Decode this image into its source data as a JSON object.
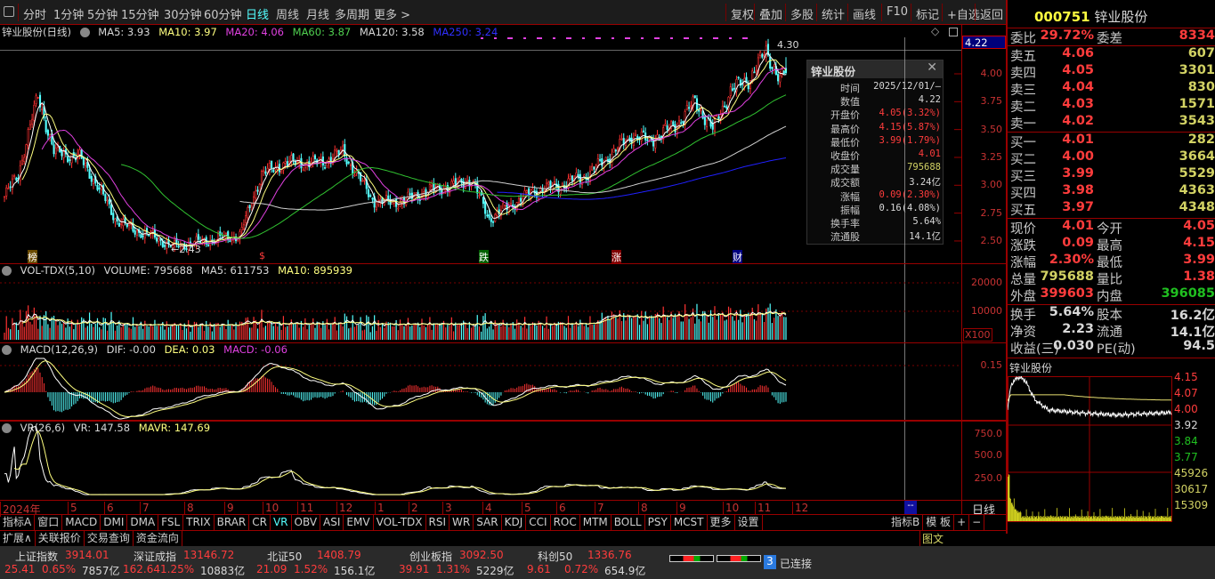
{
  "toolbar": {
    "left": [
      "分时",
      "1分钟",
      "5分钟",
      "15分钟",
      "30分钟",
      "60分钟",
      "日线",
      "周线",
      "月线",
      "多周期",
      "更多 >"
    ],
    "active": "日线",
    "right": [
      "复权",
      "叠加",
      "多股",
      "统计",
      "画线",
      "F10",
      "标记",
      "+自选",
      "返回"
    ]
  },
  "legend": {
    "title": "锌业股份(日线)",
    "ma5": "MA5: 3.93",
    "ma10": "MA10: 3.97",
    "ma20": "MA20: 4.06",
    "ma60": "MA60: 3.87",
    "ma120": "MA120: 3.58",
    "ma250": "MA250: 3.24"
  },
  "main_axis": [
    "4.00",
    "3.75",
    "3.50",
    "3.25",
    "3.00",
    "2.75",
    "2.50"
  ],
  "price_box": "4.22",
  "annotations": {
    "high": "4.30",
    "low": "←2.43",
    "markers": [
      "榜",
      "$",
      "跌",
      "涨",
      "财"
    ]
  },
  "tooltip": {
    "title": "锌业股份",
    "rows": [
      {
        "k": "时间",
        "v": "2025/12/01/—",
        "c": "wht"
      },
      {
        "k": "数值",
        "v": "4.22",
        "c": "wht"
      },
      {
        "k": "开盘价",
        "v": "4.05(3.32%)",
        "c": "red"
      },
      {
        "k": "最高价",
        "v": "4.15(5.87%)",
        "c": "red"
      },
      {
        "k": "最低价",
        "v": "3.99(1.79%)",
        "c": "red"
      },
      {
        "k": "收盘价",
        "v": "4.01",
        "c": "red"
      },
      {
        "k": "成交量",
        "v": "795688",
        "c": "yel"
      },
      {
        "k": "成交额",
        "v": "3.24亿",
        "c": "wht"
      },
      {
        "k": "涨幅",
        "v": "0.09(2.30%)",
        "c": "red"
      },
      {
        "k": "振幅",
        "v": "0.16(4.08%)",
        "c": "wht"
      },
      {
        "k": "换手率",
        "v": "5.64%",
        "c": "wht"
      },
      {
        "k": "流通股",
        "v": "14.1亿",
        "c": "wht"
      }
    ]
  },
  "vol": {
    "title": "VOL-TDX(5,10)",
    "volume": "VOLUME: 795688",
    "ma5": "MA5: 611753",
    "ma10": "MA10: 895939",
    "axis": [
      "20000",
      "10000"
    ],
    "unit": "X100"
  },
  "macd": {
    "title": "MACD(12,26,9)",
    "dif": "DIF: -0.00",
    "dea": "DEA: 0.03",
    "macd": "MACD: -0.06",
    "axis": [
      "0.15"
    ]
  },
  "vr": {
    "title": "VR(26,6)",
    "vr": "VR: 147.58",
    "mavr": "MAVR: 147.69",
    "axis": [
      "750.0",
      "500.0",
      "250.0"
    ]
  },
  "dates": [
    "2024年",
    "5",
    "6",
    "7",
    "8",
    "9",
    "10",
    "11",
    "12",
    "1",
    "2",
    "3",
    "4",
    "5",
    "6",
    "7",
    "8",
    "9",
    "10",
    "11",
    "12"
  ],
  "period_label": "日线",
  "tabs": [
    "指标A",
    "窗口",
    "MACD",
    "DMI",
    "DMA",
    "FSL",
    "TRIX",
    "BRAR",
    "CR",
    "VR",
    "OBV",
    "ASI",
    "EMV",
    "VOL-TDX",
    "RSI",
    "WR",
    "SAR",
    "KDJ",
    "CCI",
    "ROC",
    "MTM",
    "BOLL",
    "PSY",
    "MCST",
    "更多",
    "设置"
  ],
  "tabs_right": [
    "指标B",
    "模 板",
    "+",
    "−"
  ],
  "ext_tabs": [
    "扩展∧",
    "关联报价",
    "交易查询",
    "资金流向"
  ],
  "tuwen": "图文",
  "quote": {
    "code": "000751",
    "name": "锌业股份",
    "weibi": {
      "k": "委比",
      "v": "29.72%",
      "k2": "委差",
      "v2": "8334"
    },
    "sell": [
      {
        "k": "卖五",
        "p": "4.06",
        "q": "607"
      },
      {
        "k": "卖四",
        "p": "4.05",
        "q": "3301"
      },
      {
        "k": "卖三",
        "p": "4.04",
        "q": "830"
      },
      {
        "k": "卖二",
        "p": "4.03",
        "q": "1571"
      },
      {
        "k": "卖一",
        "p": "4.02",
        "q": "3543"
      }
    ],
    "buy": [
      {
        "k": "买一",
        "p": "4.01",
        "q": "282"
      },
      {
        "k": "买二",
        "p": "4.00",
        "q": "3664"
      },
      {
        "k": "买三",
        "p": "3.99",
        "q": "5529"
      },
      {
        "k": "买四",
        "p": "3.98",
        "q": "4363"
      },
      {
        "k": "买五",
        "p": "3.97",
        "q": "4348"
      }
    ],
    "stats": [
      {
        "k": "现价",
        "v": "4.01",
        "c": "red",
        "k2": "今开",
        "v2": "4.05",
        "c2": "red"
      },
      {
        "k": "涨跌",
        "v": "0.09",
        "c": "red",
        "k2": "最高",
        "v2": "4.15",
        "c2": "red"
      },
      {
        "k": "涨幅",
        "v": "2.30%",
        "c": "red",
        "k2": "最低",
        "v2": "3.99",
        "c2": "red"
      },
      {
        "k": "总量",
        "v": "795688",
        "c": "yel",
        "k2": "量比",
        "v2": "1.38",
        "c2": "red"
      },
      {
        "k": "外盘",
        "v": "399603",
        "c": "red",
        "k2": "内盘",
        "v2": "396085",
        "c2": "grn"
      }
    ],
    "fund": [
      {
        "k": "换手",
        "v": "5.64%",
        "k2": "股本",
        "v2": "16.2亿"
      },
      {
        "k": "净资",
        "v": "2.23",
        "k2": "流通",
        "v2": "14.1亿"
      },
      {
        "k": "收益(三)",
        "v": "0.030",
        "k2": "PE(动)",
        "v2": "94.5"
      }
    ]
  },
  "mini": {
    "title": "锌业股份",
    "axis": [
      {
        "v": "4.15",
        "c": "red"
      },
      {
        "v": "4.07",
        "c": "red"
      },
      {
        "v": "4.00",
        "c": "red"
      },
      {
        "v": "3.92",
        "c": "wht"
      },
      {
        "v": "3.84",
        "c": "grn"
      },
      {
        "v": "3.77",
        "c": "grn"
      },
      {
        "v": "45926",
        "c": "yel"
      },
      {
        "v": "30617",
        "c": "yel"
      },
      {
        "v": "15309",
        "c": "yel"
      }
    ]
  },
  "indices": [
    {
      "name": "上证指数",
      "val": "3914.01",
      "chg": "25.41",
      "pct": "0.65%",
      "amt": "7857亿"
    },
    {
      "name": "深证成指",
      "val": "13146.72",
      "chg": "162.64",
      "pct": "1.25%",
      "amt": "10883亿"
    },
    {
      "name": "北证50",
      "val": "1408.79",
      "chg": "21.09",
      "pct": "1.52%",
      "amt": "156.1亿"
    },
    {
      "name": "创业板指",
      "val": "3092.50",
      "chg": "39.91",
      "pct": "1.31%",
      "amt": "5229亿"
    },
    {
      "name": "科创50",
      "val": "1336.76",
      "chg": "9.61",
      "pct": "0.72%",
      "amt": "654.9亿"
    }
  ],
  "status": {
    "badge": "3",
    "text": "已连接"
  },
  "chart_data": {
    "type": "candlestick",
    "title": "锌业股份(日线)",
    "ylim": [
      2.4,
      4.3
    ],
    "key_points": [
      [
        0,
        2.9
      ],
      [
        7,
        3.1
      ],
      [
        14,
        3.6
      ],
      [
        17,
        3.8
      ],
      [
        25,
        3.3
      ],
      [
        38,
        3.25
      ],
      [
        47,
        3.0
      ],
      [
        56,
        2.7
      ],
      [
        65,
        2.6
      ],
      [
        74,
        2.55
      ],
      [
        85,
        2.45
      ],
      [
        101,
        2.5
      ],
      [
        119,
        2.55
      ],
      [
        130,
        3.1
      ],
      [
        142,
        3.2
      ],
      [
        151,
        3.2
      ],
      [
        160,
        3.2
      ],
      [
        171,
        3.3
      ],
      [
        178,
        3.1
      ],
      [
        187,
        2.85
      ],
      [
        200,
        2.85
      ],
      [
        214,
        2.95
      ],
      [
        227,
        3.0
      ],
      [
        236,
        3.05
      ],
      [
        245,
        2.7
      ],
      [
        254,
        2.8
      ],
      [
        268,
        2.95
      ],
      [
        281,
        3.0
      ],
      [
        295,
        3.1
      ],
      [
        308,
        3.3
      ],
      [
        317,
        3.45
      ],
      [
        326,
        3.4
      ],
      [
        340,
        3.55
      ],
      [
        349,
        3.75
      ],
      [
        358,
        3.5
      ],
      [
        367,
        3.85
      ],
      [
        376,
        3.95
      ],
      [
        385,
        4.2
      ],
      [
        392,
        3.95
      ],
      [
        395,
        4.01
      ]
    ],
    "last": {
      "open": 4.05,
      "high": 4.15,
      "low": 3.99,
      "close": 4.01
    },
    "intraday_key": [
      [
        0,
        4.02
      ],
      [
        5,
        4.12
      ],
      [
        15,
        4.15
      ],
      [
        25,
        4.14
      ],
      [
        40,
        4.06
      ],
      [
        60,
        4.02
      ],
      [
        100,
        4.01
      ],
      [
        160,
        4.0
      ],
      [
        240,
        4.01
      ]
    ]
  }
}
